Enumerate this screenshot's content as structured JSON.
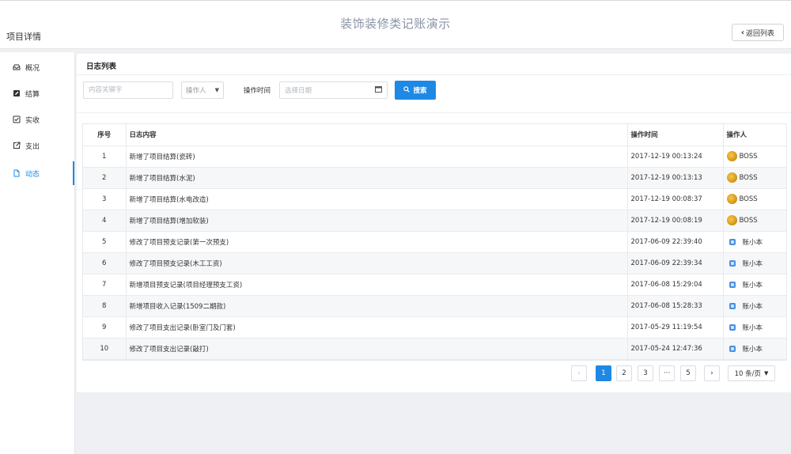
{
  "header": {
    "app_title": "装饰装修类记账演示",
    "page_title": "项目详情",
    "back_label": "返回列表"
  },
  "sidebar": {
    "items": [
      {
        "label": "概况",
        "icon": "inbox-icon"
      },
      {
        "label": "结算",
        "icon": "edit-square-icon"
      },
      {
        "label": "实收",
        "icon": "checkbox-icon"
      },
      {
        "label": "支出",
        "icon": "external-link-icon"
      },
      {
        "label": "动态",
        "icon": "file-icon"
      }
    ],
    "active_index": 4
  },
  "main": {
    "card_title": "日志列表",
    "filters": {
      "keyword_placeholder": "内容关键字",
      "operator_placeholder": "操作人",
      "time_label": "操作时间",
      "date_placeholder": "选择日期",
      "search_label": "搜索"
    },
    "table": {
      "columns": [
        "序号",
        "日志内容",
        "操作时间",
        "操作人"
      ],
      "rows": [
        {
          "no": "1",
          "content": "新增了项目结算(瓷砖)",
          "time": "2017-12-19 00:13:24",
          "user": "BOSS",
          "avatar": "boss"
        },
        {
          "no": "2",
          "content": "新增了项目结算(水泥)",
          "time": "2017-12-19 00:13:13",
          "user": "BOSS",
          "avatar": "boss"
        },
        {
          "no": "3",
          "content": "新增了项目结算(水电改造)",
          "time": "2017-12-19 00:08:37",
          "user": "BOSS",
          "avatar": "boss"
        },
        {
          "no": "4",
          "content": "新增了项目结算(增加软装)",
          "time": "2017-12-19 00:08:19",
          "user": "BOSS",
          "avatar": "boss"
        },
        {
          "no": "5",
          "content": "修改了项目预支记录(第一次预支)",
          "time": "2017-06-09 22:39:40",
          "user": "账小本",
          "avatar": "mini"
        },
        {
          "no": "6",
          "content": "修改了项目预支记录(木工工资)",
          "time": "2017-06-09 22:39:34",
          "user": "账小本",
          "avatar": "mini"
        },
        {
          "no": "7",
          "content": "新增项目预支记录(项目经理预支工资)",
          "time": "2017-06-08 15:29:04",
          "user": "账小本",
          "avatar": "mini"
        },
        {
          "no": "8",
          "content": "新增项目收入记录(1509二期款)",
          "time": "2017-06-08 15:28:33",
          "user": "账小本",
          "avatar": "mini"
        },
        {
          "no": "9",
          "content": "修改了项目支出记录(卧室门及门套)",
          "time": "2017-05-29 11:19:54",
          "user": "账小本",
          "avatar": "mini"
        },
        {
          "no": "10",
          "content": "修改了项目支出记录(敲打)",
          "time": "2017-05-24 12:47:36",
          "user": "账小本",
          "avatar": "mini"
        }
      ]
    },
    "pagination": {
      "prev": "‹",
      "pages": [
        "1",
        "2",
        "3",
        "···",
        "5"
      ],
      "next": "›",
      "current": "1",
      "per_page": "10 条/页"
    }
  }
}
